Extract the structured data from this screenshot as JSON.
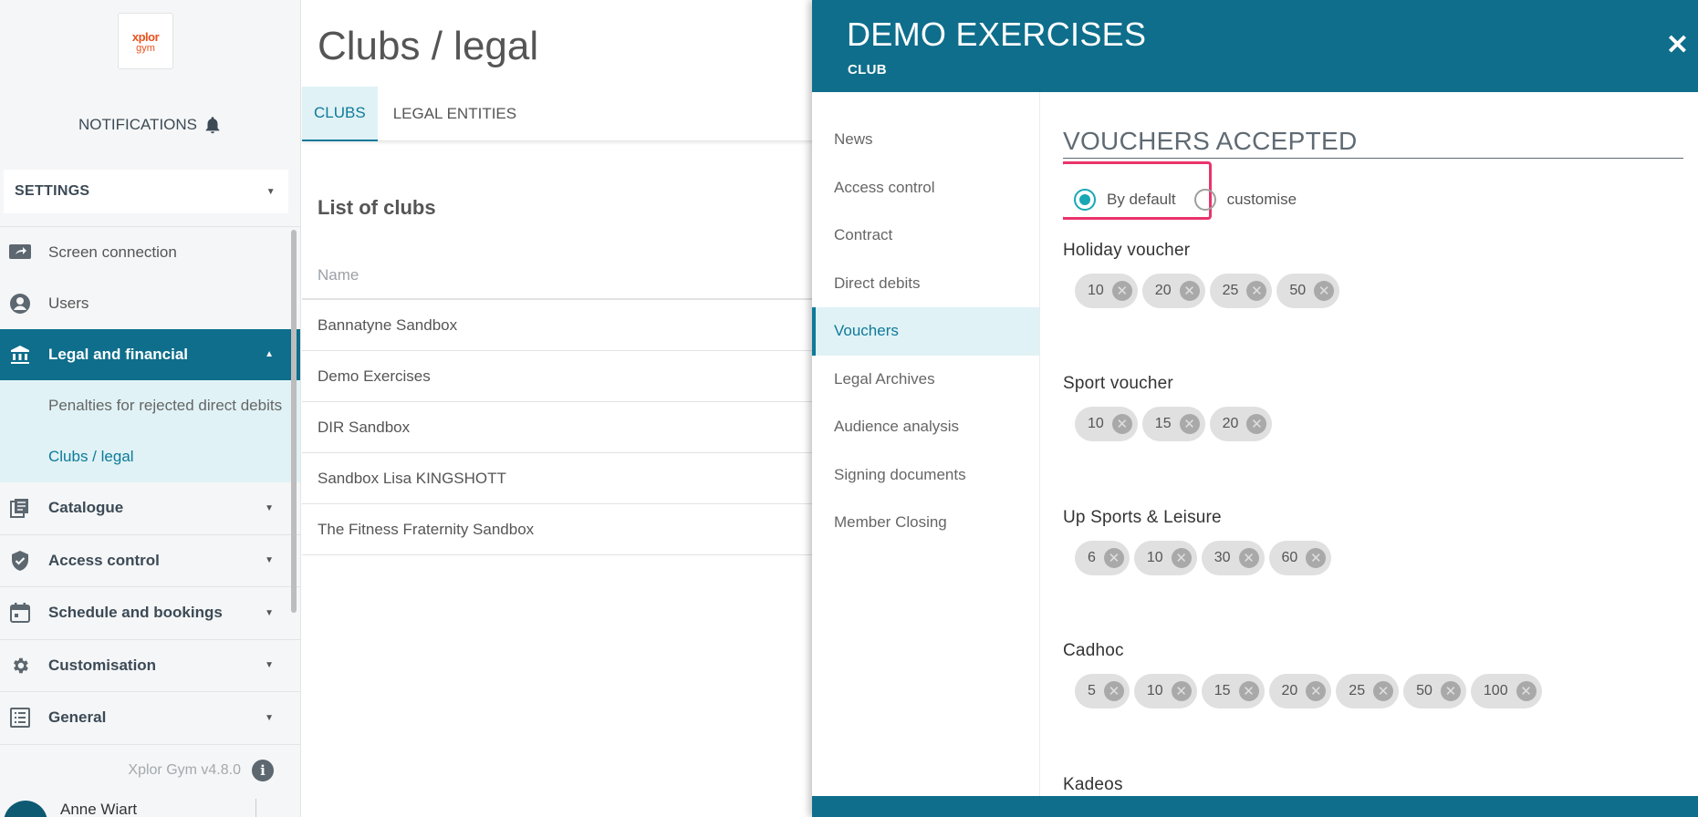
{
  "sidebar": {
    "logo": {
      "brand": "xplor",
      "brand_sub": "gym"
    },
    "notifications_label": "NOTIFICATIONS",
    "settings_label": "SETTINGS",
    "items": [
      {
        "label": "Screen connection",
        "icon": "screen-share-icon"
      },
      {
        "label": "Users",
        "icon": "user-icon"
      }
    ],
    "active_group": {
      "label": "Legal and financial",
      "icon": "bank-icon"
    },
    "subitems": [
      {
        "label": "Penalties for rejected direct debits"
      },
      {
        "label": "Clubs / legal"
      }
    ],
    "groups": [
      {
        "label": "Catalogue",
        "icon": "catalogue-icon"
      },
      {
        "label": "Access control",
        "icon": "shield-icon"
      },
      {
        "label": "Schedule and bookings",
        "icon": "calendar-icon"
      },
      {
        "label": "Customisation",
        "icon": "gear-icon"
      },
      {
        "label": "General",
        "icon": "list-icon"
      }
    ],
    "version": "Xplor Gym v4.8.0",
    "info_glyph": "i",
    "user_name": "Anne Wiart"
  },
  "main": {
    "title": "Clubs / legal",
    "tabs": [
      {
        "label": "CLUBS"
      },
      {
        "label": "LEGAL ENTITIES"
      }
    ],
    "list_title": "List of clubs",
    "column_header": "Name",
    "rows": [
      "Bannatyne Sandbox",
      "Demo Exercises",
      "DIR Sandbox",
      "Sandbox Lisa KINGSHOTT",
      "The Fitness Fraternity Sandbox"
    ]
  },
  "panel": {
    "title": "DEMO EXERCISES",
    "subtitle": "CLUB",
    "close_glyph": "✕",
    "nav": [
      "News",
      "Access control",
      "Contract",
      "Direct debits",
      "Vouchers",
      "Legal Archives",
      "Audience analysis",
      "Signing documents",
      "Member Closing"
    ],
    "current_nav": "Vouchers",
    "section_title": "VOUCHERS ACCEPTED",
    "radio": {
      "by_default": "By default",
      "customise": "customise",
      "selected": "By default"
    },
    "vouchers": [
      {
        "name": "Holiday voucher",
        "values": [
          "10",
          "20",
          "25",
          "50"
        ]
      },
      {
        "name": "Sport voucher",
        "values": [
          "10",
          "15",
          "20"
        ]
      },
      {
        "name": "Up Sports & Leisure",
        "values": [
          "6",
          "10",
          "30",
          "60"
        ]
      },
      {
        "name": "Cadhoc",
        "values": [
          "5",
          "10",
          "15",
          "20",
          "25",
          "50",
          "100"
        ]
      },
      {
        "name": "Kadeos",
        "values": []
      }
    ],
    "chip_remove_glyph": "✕"
  },
  "colors": {
    "primary": "#0e6e8c",
    "accent": "#18a7b5",
    "highlight": "#e9336b",
    "active_bg": "#e0f2f5"
  }
}
